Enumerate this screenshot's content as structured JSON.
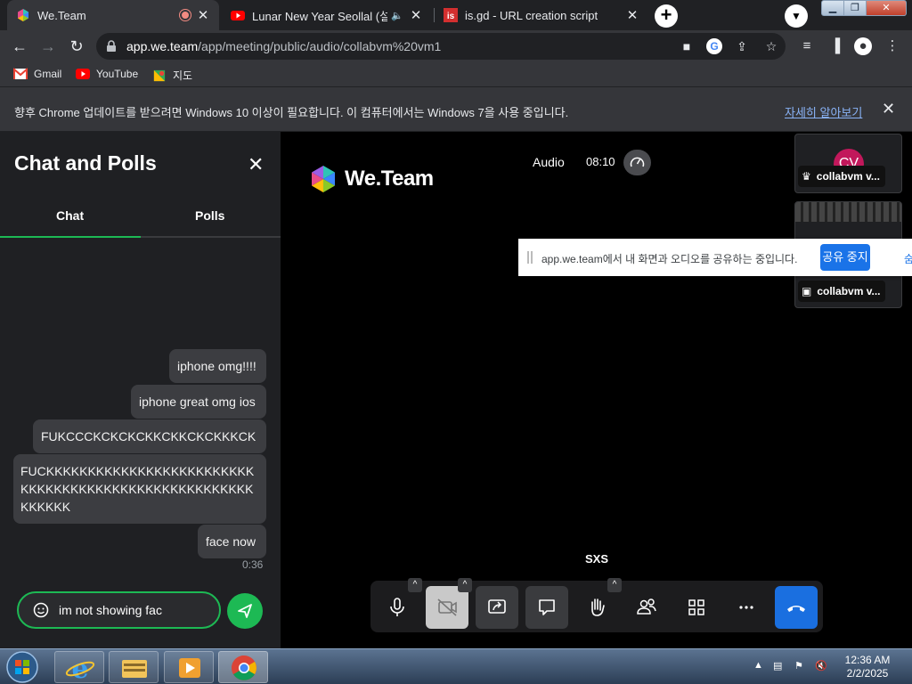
{
  "browser": {
    "tabs": [
      {
        "title": "We.Team"
      },
      {
        "title": "Lunar New Year Seollal (설날"
      },
      {
        "title": "is.gd - URL creation script"
      }
    ],
    "new_tab_label": "+",
    "url_host": "app.we.team",
    "url_path": "/app/meeting/public/audio/collabvm%20vm1",
    "bookmarks": [
      {
        "label": "Gmail"
      },
      {
        "label": "YouTube"
      },
      {
        "label": "지도"
      }
    ],
    "infobar": {
      "message": "향후 Chrome 업데이트를 받으려면 Windows 10 이상이 필요합니다. 이 컴퓨터에서는 Windows 7을 사용 중입니다.",
      "link": "자세히 알아보기"
    }
  },
  "chat": {
    "title": "Chat and Polls",
    "tabs": [
      "Chat",
      "Polls"
    ],
    "messages": [
      {
        "text": "iphone omg!!!!"
      },
      {
        "text": "iphone great omg ios"
      },
      {
        "text": "FUKCCCKCKCKCKKCKKCKCKKKCK"
      },
      {
        "text": "FUCKKKKKKKKKKKKKKKKKKKKKKKKKKKKKKKKKKKKKKKKKKKKKKKKKKKKKKKKKKK"
      },
      {
        "text": "face now"
      }
    ],
    "last_time": "0:36",
    "composer_value": "im not showing fac"
  },
  "meeting": {
    "logo_text": "We.Team",
    "mode_label": "Audio",
    "timer": "08:10",
    "participants": [
      {
        "initials": "CV",
        "name": "collabvm v...",
        "role_icon": "crown-icon"
      },
      {
        "initials": "",
        "name": "collabvm v...",
        "role_icon": "screen-share-icon"
      }
    ],
    "speaker_label": "SXS",
    "accent_color": "#1db954",
    "leave_color": "#1a6fe0"
  },
  "sharebar": {
    "message": "app.we.team에서 내 화면과 오디오를 공유하는 중입니다.",
    "stop_label": "공유 중지",
    "hide_label": "숨기기"
  },
  "taskbar": {
    "time": "12:36 AM",
    "date": "2/2/2025"
  }
}
